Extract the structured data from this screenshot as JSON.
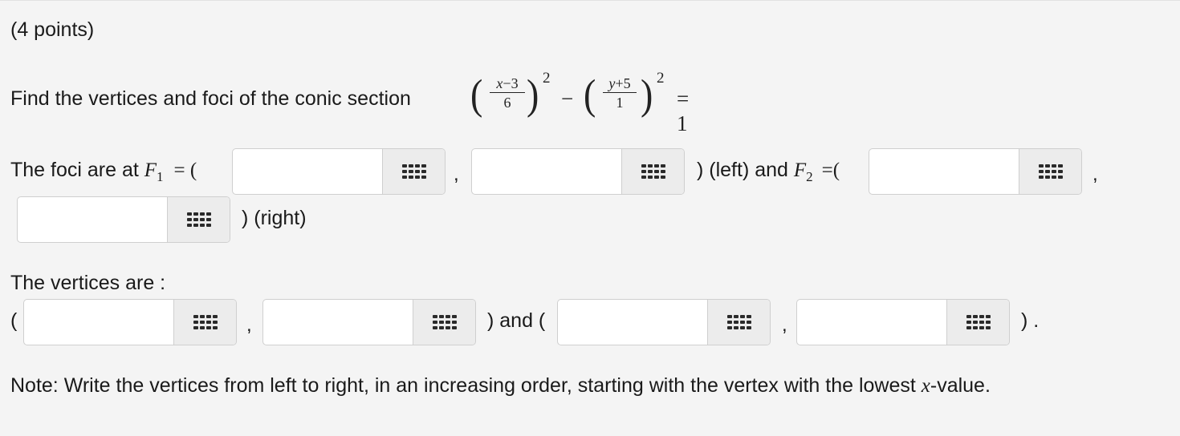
{
  "points_label": "(4 points)",
  "question": {
    "prompt": "Find the vertices and foci of the conic section",
    "equation": {
      "left_paren": "(",
      "right_paren": ")",
      "frac1_num_var": "x",
      "frac1_num_rest": "−3",
      "frac1_den": "6",
      "frac2_num_var": "y",
      "frac2_num_rest": "+5",
      "frac2_den": "1",
      "exponent": "2",
      "minus": "−",
      "rhs": "= 1"
    }
  },
  "foci": {
    "prefix": "The foci are at",
    "f1_symbol": "F",
    "f1_sub": "1",
    "f1_eq": "= (",
    "comma": ",",
    "left_label": ") (left) and",
    "f2_symbol": "F",
    "f2_sub": "2",
    "f2_eq": "=(",
    "right_label": ") (right)",
    "inputs": [
      {
        "value": "",
        "placeholder": ""
      },
      {
        "value": "",
        "placeholder": ""
      },
      {
        "value": "",
        "placeholder": ""
      },
      {
        "value": "",
        "placeholder": ""
      }
    ]
  },
  "vertices": {
    "heading": "The vertices are :",
    "open_paren": "(",
    "comma": ",",
    "and_label": ") and (",
    "close_label": ") .",
    "inputs": [
      {
        "value": "",
        "placeholder": ""
      },
      {
        "value": "",
        "placeholder": ""
      },
      {
        "value": "",
        "placeholder": ""
      },
      {
        "value": "",
        "placeholder": ""
      }
    ]
  },
  "note": {
    "text": "Note: Write the vertices from left to right, in an increasing order, starting with the vertex with the lowest",
    "var": "x",
    "suffix": "-value."
  },
  "icons": {
    "input_button": "keypad-icon"
  }
}
